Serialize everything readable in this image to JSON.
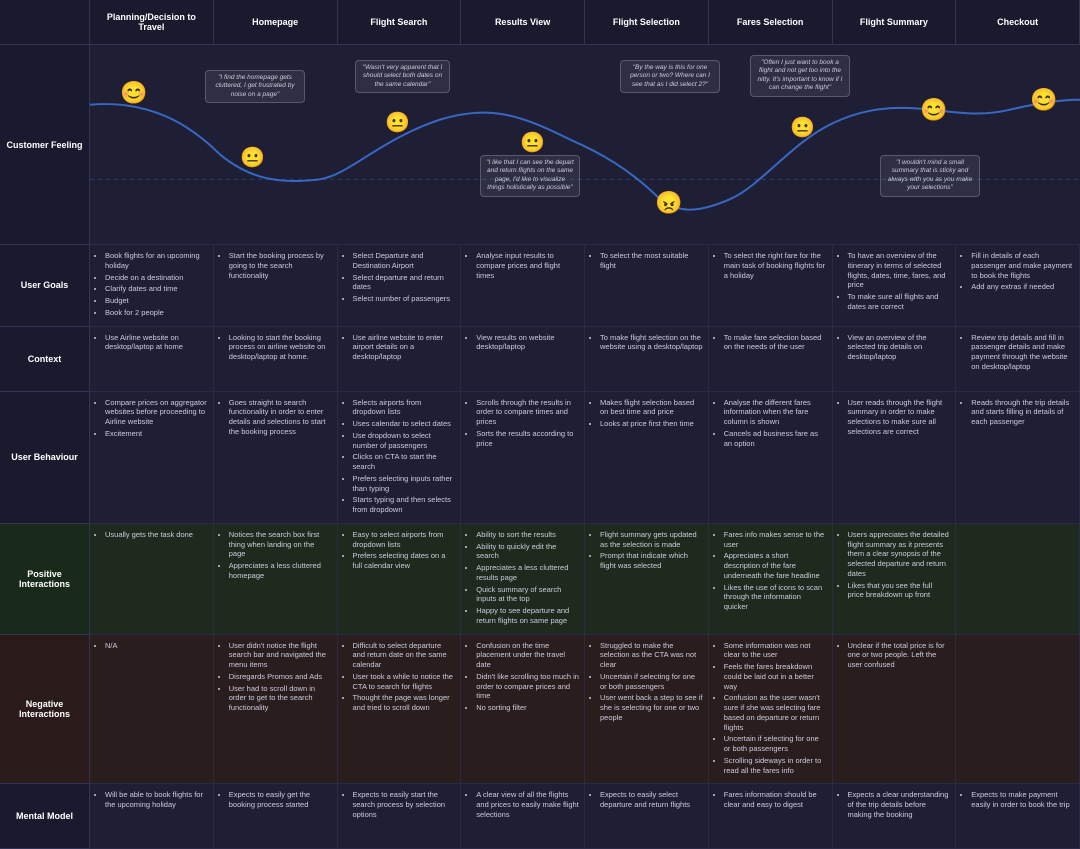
{
  "columns": [
    "",
    "Planning/Decision to Travel",
    "Homepage",
    "Flight Search",
    "Results View",
    "Flight Selection",
    "Fares Selection",
    "Flight Summary",
    "Checkout"
  ],
  "rows": [
    {
      "label": "Customer Feeling",
      "type": "feeling"
    },
    {
      "label": "User Goals",
      "type": "content",
      "cells": [
        [
          "Book flights for an upcoming holiday",
          "Decide on a destination",
          "Clarify dates and time",
          "Budget",
          "Book for 2 people"
        ],
        [
          "Start the booking process by going to the search functionality"
        ],
        [
          "Select Departure and Destination Airport",
          "Select departure and return dates",
          "Select number of passengers"
        ],
        [
          "Analyse input results to compare prices and flight times"
        ],
        [
          "To select the most suitable flight"
        ],
        [
          "To select the right fare for the main task of booking flights for a holiday"
        ],
        [
          "To have an overview of the itinerary in terms of selected flights, dates, time, fares, and price",
          "To make sure all flights and dates are correct"
        ],
        [
          "Fill in details of each passenger and make payment to book the flights",
          "Add any extras if needed"
        ]
      ]
    },
    {
      "label": "Context",
      "type": "content",
      "cells": [
        [
          "Use Airline website on desktop/laptop at home"
        ],
        [
          "Looking to start the booking process on airline website on desktop/laptop at home."
        ],
        [
          "Use airline website to enter airport details on a desktop/laptop"
        ],
        [
          "View results on website desktop/laptop"
        ],
        [
          "To make flight selection on the website using a desktop/laptop"
        ],
        [
          "To make fare selection based on the needs of the user"
        ],
        [
          "View an overview of the selected trip details on desktop/laptop"
        ],
        [
          "Review trip details and fill in passenger details and make payment through the website on desktop/laptop"
        ]
      ]
    },
    {
      "label": "User Behaviour",
      "type": "content",
      "cells": [
        [
          "Compare prices on aggregator websites before proceeding to Airline website",
          "Excitement"
        ],
        [
          "Goes straight to search functionality in order to enter details and selections to start the booking process"
        ],
        [
          "Selects airports from dropdown lists",
          "Uses calendar to select dates",
          "Use dropdown to select number of passengers",
          "Clicks on CTA to start the search",
          "Prefers selecting inputs rather than typing",
          "Starts typing and then selects from dropdown"
        ],
        [
          "Scrolls through the results in order to compare times and prices",
          "Sorts the results according to price"
        ],
        [
          "Makes flight selection based on best time and price",
          "Looks at price first then time"
        ],
        [
          "Analyse the different fares information when the fare column is shown",
          "Cancels ad business fare as an option"
        ],
        [
          "User reads through the flight summary in order to make selections to make sure all selections are correct"
        ],
        [
          "Reads through the trip details and starts filling in details of each passenger"
        ]
      ]
    },
    {
      "label": "Positive Interactions",
      "type": "content",
      "cells": [
        [
          "Usually gets the task done"
        ],
        [
          "Notices the search box first thing when landing on the page",
          "Appreciates a less cluttered homepage"
        ],
        [
          "Easy to select airports from dropdown lists",
          "Prefers selecting dates on a full calendar view"
        ],
        [
          "Ability to sort the results",
          "Ability to quickly edit the search",
          "Appreciates a less cluttered results page",
          "Quick summary of search inputs at the top",
          "Happy to see departure and return flights on same page"
        ],
        [
          "Flight summary gets updated as the selection is made",
          "Prompt that indicate which flight was selected"
        ],
        [
          "Fares info makes sense to the user",
          "Appreciates a short description of the fare underneath the fare headline",
          "Likes the use of icons to scan through the information quicker"
        ],
        [
          "Users appreciates the detailed flight summary as it presents them a clear synopsis of the selected departure and return dates",
          "Likes that you see the full price breakdown up front"
        ],
        [
          ""
        ]
      ]
    },
    {
      "label": "Negative Interactions",
      "type": "content",
      "cells": [
        [
          "N/A"
        ],
        [
          "User didn't notice the flight search bar and navigated the menu items",
          "Disregards Promos and Ads",
          "User had to scroll down in order to get to the search functionality"
        ],
        [
          "Difficult to select departure and return date on the same calendar",
          "User took a while to notice the CTA to search for flights",
          "Thought the page was longer and tried to scroll down"
        ],
        [
          "Confusion on the time placement under the travel date",
          "Didn't like scrolling too much in order to compare prices and time",
          "No sorting filter"
        ],
        [
          "Struggled to make the selection as the CTA was not clear",
          "Uncertain if selecting for one or both passengers",
          "User went back a step to see if she is selecting for one or two people"
        ],
        [
          "Some information was not clear to the user",
          "Feels the fares breakdown could be laid out in a better way",
          "Confusion as the user wasn't sure if she was selecting fare based on departure or return flights",
          "Uncertain if selecting for one or both passengers",
          "Scrolling sideways in order to read all the fares info"
        ],
        [
          "Unclear if the total price is for one or two people. Left the user confused"
        ],
        [
          ""
        ]
      ]
    },
    {
      "label": "Mental Model",
      "type": "content",
      "cells": [
        [
          "Will be able to book flights for the upcoming holiday"
        ],
        [
          "Expects to easily get the booking process started"
        ],
        [
          "Expects to easily start the search process by selection options"
        ],
        [
          "A clear view of all the flights and prices to easily make flight selections"
        ],
        [
          "Expects to easily select departure and return flights"
        ],
        [
          "Fares information should be clear and easy to digest"
        ],
        [
          "Expects a clear understanding of the trip details before making the booking"
        ],
        [
          "Expects to make payment easily in order to book the trip"
        ]
      ]
    }
  ],
  "quotes": [
    {
      "text": "\"I find the homepage gets cluttered, I get frustrated by noise on a page\"",
      "col": 2
    },
    {
      "text": "\"Wasn't very apparent that I should select both dates on the same calendar\"",
      "col": 3
    },
    {
      "text": "\"By the way is this for one person or two? Where can I see that as I did select 2?\"",
      "col": 5
    },
    {
      "text": "\"Often I just want to book a flight and not get too into the nitty. It's important to know if I can change the flight\"",
      "col": 6
    },
    {
      "text": "\"I wouldn't mind a small summary that is sticky and always with you as you make your selections\"",
      "col": 7
    },
    {
      "text": "\"I like that I can see the depart and return flights on the same page, I'd like to visualize things holistically as possible\"",
      "col": 4
    }
  ],
  "emojis": [
    {
      "col": 1,
      "type": "happy",
      "char": "😊"
    },
    {
      "col": 2,
      "type": "neutral",
      "char": "😐"
    },
    {
      "col": 3,
      "type": "neutral",
      "char": "😐"
    },
    {
      "col": 4,
      "type": "neutral",
      "char": "😐"
    },
    {
      "col": 5,
      "type": "angry",
      "char": "😡"
    },
    {
      "col": 6,
      "type": "neutral",
      "char": "😐"
    },
    {
      "col": 7,
      "type": "happy",
      "char": "😊"
    },
    {
      "col": 8,
      "type": "happy",
      "char": "😊"
    }
  ]
}
